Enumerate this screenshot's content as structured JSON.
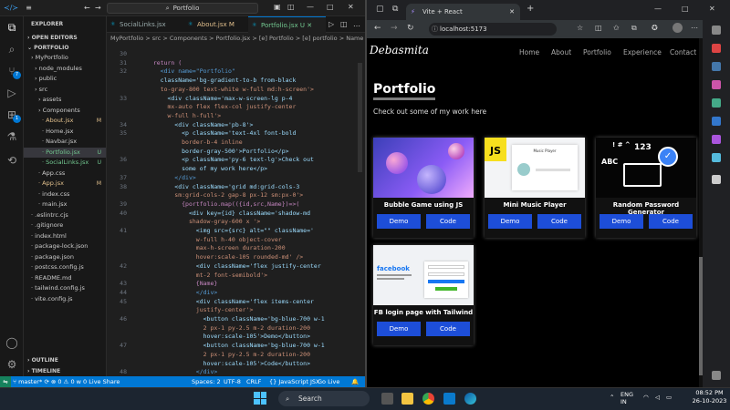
{
  "vscode": {
    "title_search": "Portfolio",
    "tabs": [
      {
        "label": "SocialLinks.jsx",
        "marker": "U"
      },
      {
        "label": "About.jsx",
        "marker": "M"
      },
      {
        "label": "Portfolio.jsx",
        "marker": "U"
      }
    ],
    "breadcrumb": "MyPortfolio > src > Components > Portfolio.jsx > [e] Portfolio > [e] portfolio > Name",
    "explorer": {
      "title": "EXPLORER",
      "open_editors": "OPEN EDITORS",
      "root": "PORTFOLIO",
      "items": [
        {
          "label": "MyPortfolio",
          "marker": ""
        },
        {
          "label": "node_modules",
          "marker": ""
        },
        {
          "label": "public",
          "marker": ""
        },
        {
          "label": "src",
          "marker": ""
        },
        {
          "label": "assets",
          "marker": ""
        },
        {
          "label": "Components",
          "marker": ""
        },
        {
          "label": "About.jsx",
          "marker": "M"
        },
        {
          "label": "Home.jsx",
          "marker": ""
        },
        {
          "label": "Navbar.jsx",
          "marker": ""
        },
        {
          "label": "Portfolio.jsx",
          "marker": "U"
        },
        {
          "label": "SocialLinks.jsx",
          "marker": "U"
        },
        {
          "label": "App.css",
          "marker": ""
        },
        {
          "label": "App.jsx",
          "marker": "M"
        },
        {
          "label": "index.css",
          "marker": ""
        },
        {
          "label": "main.jsx",
          "marker": ""
        },
        {
          "label": ".eslintrc.cjs",
          "marker": ""
        },
        {
          "label": ".gitignore",
          "marker": ""
        },
        {
          "label": "index.html",
          "marker": ""
        },
        {
          "label": "package-lock.json",
          "marker": ""
        },
        {
          "label": "package.json",
          "marker": ""
        },
        {
          "label": "postcss.config.js",
          "marker": ""
        },
        {
          "label": "README.md",
          "marker": ""
        },
        {
          "label": "tailwind.config.js",
          "marker": ""
        },
        {
          "label": "vite.config.js",
          "marker": ""
        }
      ],
      "outline": "OUTLINE",
      "timeline": "TIMELINE"
    },
    "code_lines": [
      {
        "n": "30",
        "t": ""
      },
      {
        "n": "31",
        "t": "  return ("
      },
      {
        "n": "32",
        "t": "    <div name=\"Portfolio\""
      },
      {
        "n": "",
        "t": "    className='bg-gradient-to-b from-black"
      },
      {
        "n": "",
        "t": "    to-gray-800 text-white w-full md:h-screen'>"
      },
      {
        "n": "33",
        "t": "      <div className='max-w-screen-lg p-4"
      },
      {
        "n": "",
        "t": "      mx-auto flex flex-col justify-center"
      },
      {
        "n": "",
        "t": "      w-full h-full'>"
      },
      {
        "n": "34",
        "t": "        <div className='pb-8'>"
      },
      {
        "n": "35",
        "t": "          <p className='text-4xl font-bold"
      },
      {
        "n": "",
        "t": "          border-b-4 inline"
      },
      {
        "n": "",
        "t": "          border-gray-500'>Portfolio</p>"
      },
      {
        "n": "36",
        "t": "          <p className='py-6 text-lg'>Check out"
      },
      {
        "n": "",
        "t": "          some of my work here</p>"
      },
      {
        "n": "37",
        "t": "        </div>"
      },
      {
        "n": "38",
        "t": "        <div className='grid md:grid-cols-3"
      },
      {
        "n": "",
        "t": "        sm:grid-cols-2 gap-8 px-12 sm:px-0'>"
      },
      {
        "n": "39",
        "t": "          {portfolio.map(({id,src,Name})=>("
      },
      {
        "n": "40",
        "t": "            <div key={id} className='shadow-md"
      },
      {
        "n": "",
        "t": "            shadow-gray-600 x '>"
      },
      {
        "n": "41",
        "t": "              <img src={src} alt=\"\" className='"
      },
      {
        "n": "",
        "t": "              w-full h-40 object-cover"
      },
      {
        "n": "",
        "t": "              max-h-screen duration-200"
      },
      {
        "n": "",
        "t": "              hover:scale-105 rounded-md' />"
      },
      {
        "n": "42",
        "t": "              <div className='flex justify-center"
      },
      {
        "n": "",
        "t": "              mt-2 font-semibold'>"
      },
      {
        "n": "43",
        "t": "              {Name}"
      },
      {
        "n": "44",
        "t": "              </div>"
      },
      {
        "n": "45",
        "t": "              <div className='flex items-center"
      },
      {
        "n": "",
        "t": "              justify-center'>"
      },
      {
        "n": "46",
        "t": "                <button className='bg-blue-700 w-1"
      },
      {
        "n": "",
        "t": "                2 px-1 py-2.5 m-2 duration-200"
      },
      {
        "n": "",
        "t": "                hover:scale-105'>Demo</button>"
      },
      {
        "n": "47",
        "t": "                <button className='bg-blue-700 w-1"
      },
      {
        "n": "",
        "t": "                2 px-1 py-2.5 m-2 duration-200"
      },
      {
        "n": "",
        "t": "                hover:scale-105'>Code</button>"
      },
      {
        "n": "48",
        "t": "              </div>"
      }
    ],
    "status": {
      "branch": "master*",
      "sync": "⟳",
      "errors": "⊗ 0 ⚠ 0",
      "ports": "ᴡ 0",
      "live_share": "Live Share",
      "spaces": "Spaces: 2",
      "encoding": "UTF-8",
      "eol": "CRLF",
      "language": "{} JavaScript JSX",
      "go_live": "Go Live"
    }
  },
  "browser": {
    "tab_title": "Vite + React",
    "url": "localhost:5173",
    "site": {
      "logo": "Debasmita",
      "nav": [
        "Home",
        "About",
        "Portfolio",
        "Experience",
        "Contact"
      ],
      "heading": "Portfolio",
      "subheading": "Check out some of my work here",
      "projects": [
        {
          "name": "Bubble Game using JS",
          "demo": "Demo",
          "code": "Code"
        },
        {
          "name": "Mini Music Player",
          "demo": "Demo",
          "code": "Code"
        },
        {
          "name": "Random Password Generator",
          "demo": "Demo",
          "code": "Code"
        },
        {
          "name": "FB login page with Tailwind",
          "demo": "Demo",
          "code": "Code"
        }
      ],
      "thumb_text": {
        "js": "JS",
        "music": "Music Player",
        "pw_top": "! # ^",
        "pw_num": "123",
        "pw_abc": "ABC",
        "fb": "facebook"
      }
    }
  },
  "taskbar": {
    "search": "Search",
    "lang": "ENG",
    "region": "IN",
    "time": "08:52 PM",
    "date": "26-10-2023"
  },
  "colors": {
    "vscode_bg": "#1f1f1f",
    "status_bar": "#0078d4",
    "button_blue": "#1d4ed8",
    "modified": "#e2c08d",
    "untracked": "#73c991"
  }
}
